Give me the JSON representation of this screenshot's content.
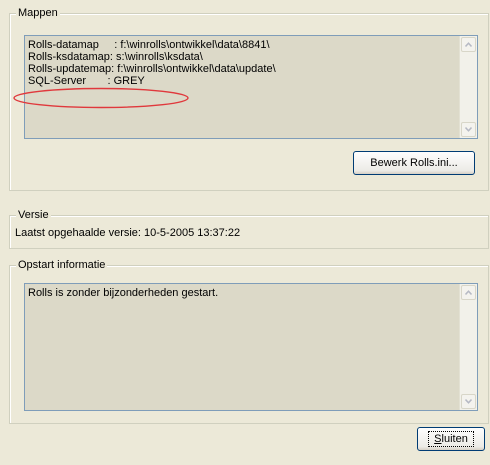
{
  "mappen": {
    "legend": "Mappen",
    "lines": [
      "Rolls-datamap     : f:\\winrolls\\ontwikkel\\data\\8841\\",
      "Rolls-ksdatamap: s:\\winrolls\\ksdata\\",
      "Rolls-updatemap: f:\\winrolls\\ontwikkel\\data\\update\\",
      "SQL-Server       : GREY"
    ],
    "highlight_color": "#e0383c",
    "edit_button_label": "Bewerk Rolls.ini..."
  },
  "versie": {
    "legend": "Versie",
    "text": "Laatst opgehaalde versie: 10-5-2005 13:37:22"
  },
  "opstart": {
    "legend": "Opstart informatie",
    "text": "Rolls is zonder bijzonderheden gestart."
  },
  "close_button": {
    "label": "Sluiten",
    "mnemonic": "S"
  }
}
